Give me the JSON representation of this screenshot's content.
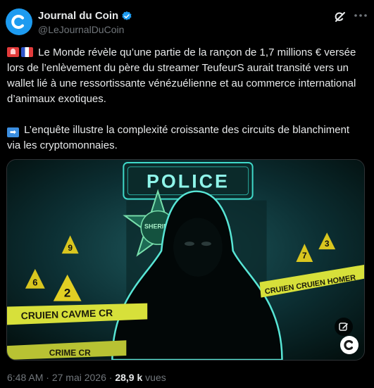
{
  "author": {
    "display_name": "Journal du Coin",
    "handle": "@LeJournalDuCoin",
    "avatar_icon": "journal-du-coin-logo-icon",
    "verified_icon": "verified-badge-icon"
  },
  "actions": {
    "grok_icon": "grok-icon",
    "more_icon": "more-icon"
  },
  "tweet": {
    "paragraph1_text": "Le Monde révèle qu’une partie de la rançon de 1,7 millions € versée lors de l’enlèvement du père du streamer TeufeurS aurait transité vers un wallet lié à une ressortissante vénézuélienne et au commerce international d’animaux exotiques.",
    "paragraph1_emojis": [
      "siren-emoji",
      "france-flag-emoji"
    ],
    "paragraph2_text": "L’enquête illustre la complexité croissante des circuits de blanchiment via les cryptomonnaies.",
    "paragraph2_emoji": "right-arrow-emoji"
  },
  "media": {
    "police_sign": "POLICE",
    "badge_text": "SHERIFF",
    "tape_left": "CRUIEN CAVME CR",
    "tape_right": "CRUIEN CRUIEN HOMER",
    "tape_bottom": "CRIME CR",
    "markers": [
      "9",
      "6",
      "2",
      "7",
      "3"
    ],
    "edit_icon": "edit-image-icon",
    "logo_icon": "journal-du-coin-watermark-icon"
  },
  "meta": {
    "time": "6:48 AM",
    "separator": "·",
    "date": "27 mai 2026",
    "views_count": "28,9 k",
    "views_label": "vues"
  },
  "colors": {
    "accent": "#1d9bf0",
    "background": "#000000",
    "text": "#e7e9ea",
    "muted": "#71767b"
  }
}
